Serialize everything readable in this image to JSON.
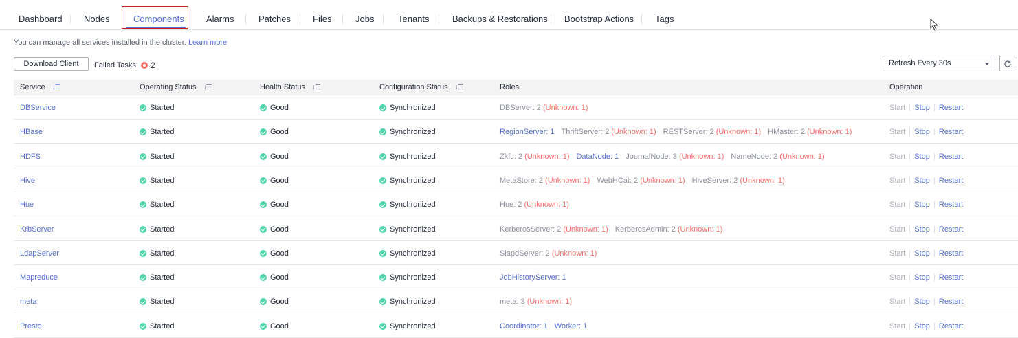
{
  "tabs": [
    {
      "label": "Dashboard",
      "active": false
    },
    {
      "label": "Nodes",
      "active": false
    },
    {
      "label": "Components",
      "active": true
    },
    {
      "label": "Alarms",
      "active": false
    },
    {
      "label": "Patches",
      "active": false
    },
    {
      "label": "Files",
      "active": false
    },
    {
      "label": "Jobs",
      "active": false
    },
    {
      "label": "Tenants",
      "active": false
    },
    {
      "label": "Backups & Restorations",
      "active": false
    },
    {
      "label": "Bootstrap Actions",
      "active": false
    },
    {
      "label": "Tags",
      "active": false
    }
  ],
  "hint": {
    "text": "You can manage all services installed in the cluster.",
    "link": "Learn more"
  },
  "toolbar": {
    "download_label": "Download Client",
    "failed_label": "Failed Tasks:",
    "failed_count": "2",
    "refresh_select": "Refresh Every 30s"
  },
  "table": {
    "headers": [
      "Service",
      "Operating Status",
      "Health Status",
      "Configuration Status",
      "Roles",
      "Operation"
    ],
    "operations": [
      "Start",
      "Stop",
      "Restart"
    ],
    "rows": [
      {
        "service": "DBService",
        "operating": "Started",
        "health": "Good",
        "config": "Synchronized",
        "roles": [
          {
            "text": "DBServer: 2",
            "unknown": "(Unknown: 1)",
            "link": false
          }
        ]
      },
      {
        "service": "HBase",
        "operating": "Started",
        "health": "Good",
        "config": "Synchronized",
        "roles": [
          {
            "text": "RegionServer: 1",
            "unknown": "",
            "link": true
          },
          {
            "text": "ThriftServer: 2",
            "unknown": "(Unknown: 1)",
            "link": false
          },
          {
            "text": "RESTServer: 2",
            "unknown": "(Unknown: 1)",
            "link": false
          },
          {
            "text": "HMaster: 2",
            "unknown": "(Unknown: 1)",
            "link": false
          }
        ]
      },
      {
        "service": "HDFS",
        "operating": "Started",
        "health": "Good",
        "config": "Synchronized",
        "roles": [
          {
            "text": "Zkfc: 2",
            "unknown": "(Unknown: 1)",
            "link": false
          },
          {
            "text": "DataNode: 1",
            "unknown": "",
            "link": true
          },
          {
            "text": "JournalNode: 3",
            "unknown": "(Unknown: 1)",
            "link": false
          },
          {
            "text": "NameNode: 2",
            "unknown": "(Unknown: 1)",
            "link": false
          }
        ]
      },
      {
        "service": "Hive",
        "operating": "Started",
        "health": "Good",
        "config": "Synchronized",
        "roles": [
          {
            "text": "MetaStore: 2",
            "unknown": "(Unknown: 1)",
            "link": false
          },
          {
            "text": "WebHCat: 2",
            "unknown": "(Unknown: 1)",
            "link": false
          },
          {
            "text": "HiveServer: 2",
            "unknown": "(Unknown: 1)",
            "link": false
          }
        ]
      },
      {
        "service": "Hue",
        "operating": "Started",
        "health": "Good",
        "config": "Synchronized",
        "roles": [
          {
            "text": "Hue: 2",
            "unknown": "(Unknown: 1)",
            "link": false
          }
        ]
      },
      {
        "service": "KrbServer",
        "operating": "Started",
        "health": "Good",
        "config": "Synchronized",
        "roles": [
          {
            "text": "KerberosServer: 2",
            "unknown": "(Unknown: 1)",
            "link": false
          },
          {
            "text": "KerberosAdmin: 2",
            "unknown": "(Unknown: 1)",
            "link": false
          }
        ]
      },
      {
        "service": "LdapServer",
        "operating": "Started",
        "health": "Good",
        "config": "Synchronized",
        "roles": [
          {
            "text": "SlapdServer: 2",
            "unknown": "(Unknown: 1)",
            "link": false
          }
        ]
      },
      {
        "service": "Mapreduce",
        "operating": "Started",
        "health": "Good",
        "config": "Synchronized",
        "roles": [
          {
            "text": "JobHistoryServer: 1",
            "unknown": "",
            "link": true
          }
        ]
      },
      {
        "service": "meta",
        "operating": "Started",
        "health": "Good",
        "config": "Synchronized",
        "roles": [
          {
            "text": "meta: 3",
            "unknown": "(Unknown: 1)",
            "link": false
          }
        ]
      },
      {
        "service": "Presto",
        "operating": "Started",
        "health": "Good",
        "config": "Synchronized",
        "roles": [
          {
            "text": "Coordinator: 1",
            "unknown": "",
            "link": true
          },
          {
            "text": "Worker: 1",
            "unknown": "",
            "link": true
          }
        ]
      }
    ]
  }
}
